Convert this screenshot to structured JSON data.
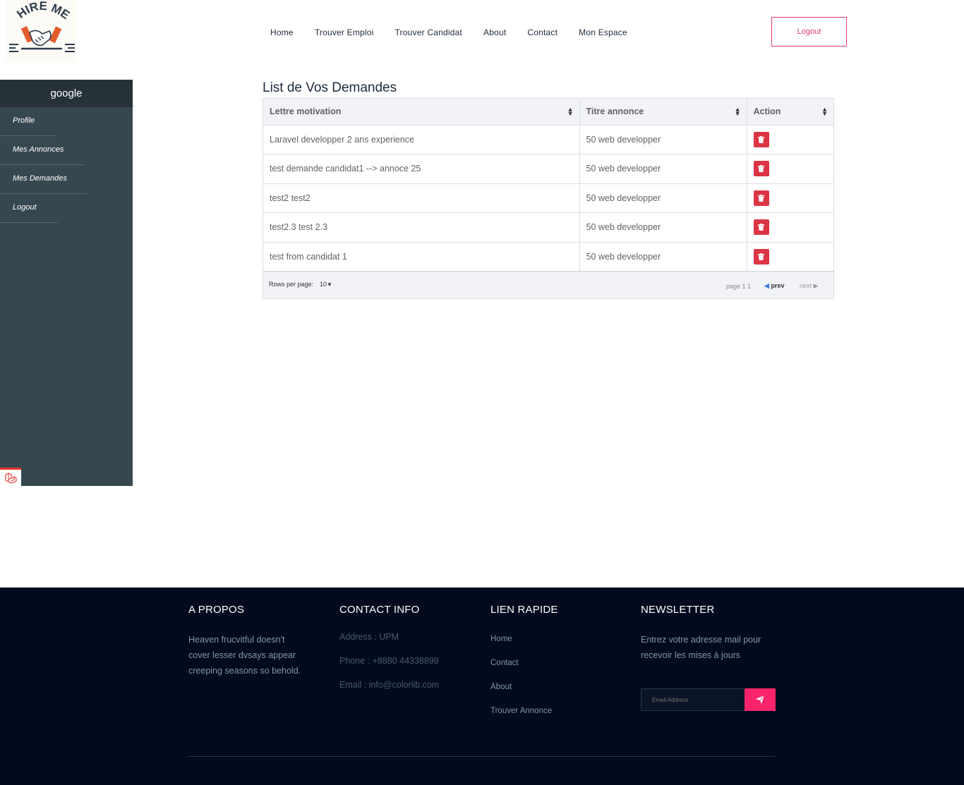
{
  "header": {
    "logo_text": "HIRE ME",
    "nav": [
      "Home",
      "Trouver Emploi",
      "Trouver Candidat",
      "About",
      "Contact",
      "Mon Espace"
    ],
    "logout_label": "Logout"
  },
  "sidebar": {
    "title": "google",
    "items": [
      {
        "label": "Profile"
      },
      {
        "label": "Mes Annonces"
      },
      {
        "label": "Mes Demandes"
      },
      {
        "label": "Logout"
      }
    ]
  },
  "main": {
    "title": "List de Vos Demandes",
    "columns": [
      "Lettre motivation",
      "Titre annonce",
      "Action"
    ],
    "rows": [
      {
        "lettre": "Laravel developper 2 ans experience",
        "titre": "50 web developper"
      },
      {
        "lettre": "test demande candidat1 --> annoce 25",
        "titre": "50 web developper"
      },
      {
        "lettre": "test2 test2",
        "titre": "50 web developper"
      },
      {
        "lettre": "test2.3 test 2.3",
        "titre": "50 web developper"
      },
      {
        "lettre": "test from candidat 1",
        "titre": "50 web developper"
      }
    ],
    "pagination": {
      "rows_per_page_label": "Rows per page:",
      "rows_per_page_value": "10",
      "page_info": "page 1 1",
      "prev_label": "prev",
      "next_label": "next"
    }
  },
  "footer": {
    "about": {
      "title": "A PROPOS",
      "text": "Heaven frucvitful doesn't cover lesser dvsays appear creeping seasons so behold."
    },
    "contact": {
      "title": "CONTACT INFO",
      "address": "Address : UPM",
      "phone": "Phone : +8880 44338899",
      "email": "Email : info@colorlib.com"
    },
    "quick_links": {
      "title": "LIEN RAPIDE",
      "links": [
        "Home",
        "Contact",
        "About",
        "Trouver Annonce"
      ]
    },
    "newsletter": {
      "title": "NEWSLETTER",
      "text": "Entrez votre adresse mail pour recevoir les mises à jours",
      "placeholder": "Email Address"
    }
  },
  "colors": {
    "accent": "#fb246a",
    "sidebar": "#37474f",
    "sidebar_head": "#263238",
    "delete": "#dc3545",
    "footer_bg": "#010b1d"
  }
}
